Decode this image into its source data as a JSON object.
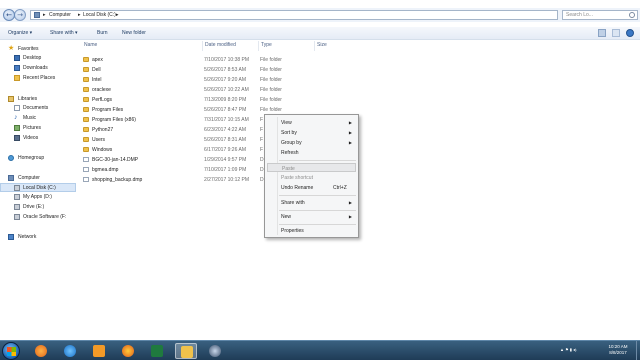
{
  "address": {
    "crumbs": [
      "Computer",
      "Local Disk (C:)"
    ],
    "search_placeholder": "Search Lo..."
  },
  "toolbar": {
    "organize": "Organize ▾",
    "share_with": "Share with ▾",
    "burn": "Burn",
    "new_folder": "New folder"
  },
  "nav": {
    "favorites": "Favorites",
    "desktop": "Desktop",
    "downloads": "Downloads",
    "recent_places": "Recent Places",
    "libraries": "Libraries",
    "documents": "Documents",
    "music": "Music",
    "pictures": "Pictures",
    "videos": "Videos",
    "homegroup": "Homegroup",
    "computer": "Computer",
    "local_disk": "Local Disk (C:)",
    "my_apps": "My Apps (D:)",
    "drive_e": "Drive (E:)",
    "oracle_software": "Oracle Software (F:",
    "network": "Network"
  },
  "columns": {
    "name": "Name",
    "date": "Date modified",
    "type": "Type",
    "size": "Size"
  },
  "files": [
    {
      "name": "apex",
      "date": "7/10/2017 10:38 PM",
      "type": "File folder",
      "size": "",
      "kind": "folder"
    },
    {
      "name": "Dell",
      "date": "5/26/2017 8:53 AM",
      "type": "File folder",
      "size": "",
      "kind": "folder"
    },
    {
      "name": "Intel",
      "date": "5/26/2017 9:20 AM",
      "type": "File folder",
      "size": "",
      "kind": "folder"
    },
    {
      "name": "oraclexe",
      "date": "5/26/2017 10:22 AM",
      "type": "File folder",
      "size": "",
      "kind": "folder"
    },
    {
      "name": "PerfLogs",
      "date": "7/13/2009 8:20 PM",
      "type": "File folder",
      "size": "",
      "kind": "folder"
    },
    {
      "name": "Program Files",
      "date": "5/26/2017 8:47 PM",
      "type": "File folder",
      "size": "",
      "kind": "folder"
    },
    {
      "name": "Program Files (x86)",
      "date": "7/31/2017 10:15 AM",
      "type": "F",
      "size": "",
      "kind": "folder"
    },
    {
      "name": "Python27",
      "date": "6/23/2017 4:22 AM",
      "type": "F",
      "size": "",
      "kind": "folder"
    },
    {
      "name": "Users",
      "date": "5/26/2017 8:31 AM",
      "type": "F",
      "size": "",
      "kind": "folder"
    },
    {
      "name": "Windows",
      "date": "6/17/2017 9:26 AM",
      "type": "F",
      "size": "",
      "kind": "folder"
    },
    {
      "name": "BGC-30-jan-14.DMP",
      "date": "1/29/2014 9:57 PM",
      "type": "D",
      "size": "",
      "kind": "dmp"
    },
    {
      "name": "bgmea.dmp",
      "date": "7/10/2017 1:09 PM",
      "type": "D",
      "size": "",
      "kind": "dmp"
    },
    {
      "name": "shopping_backup.dmp",
      "date": "2/27/2017 10:12 PM",
      "type": "D",
      "size": "",
      "kind": "dmp"
    }
  ],
  "context_menu": {
    "view": "View",
    "sort_by": "Sort by",
    "group_by": "Group by",
    "refresh": "Refresh",
    "paste": "Paste",
    "paste_shortcut": "Paste shortcut",
    "undo_rename": "Undo Rename",
    "undo_shortcut": "Ctrl+Z",
    "share_with": "Share with",
    "new": "New",
    "properties": "Properties"
  },
  "taskbar": {
    "tray": "▲ ⚑ ▮ ◂)",
    "time": "10:20 AM",
    "date": "8/8/2017"
  },
  "colors": {
    "folder": "#f0c24b",
    "taskbar": "#2b4c6a",
    "selection": "#d9e7f8"
  }
}
